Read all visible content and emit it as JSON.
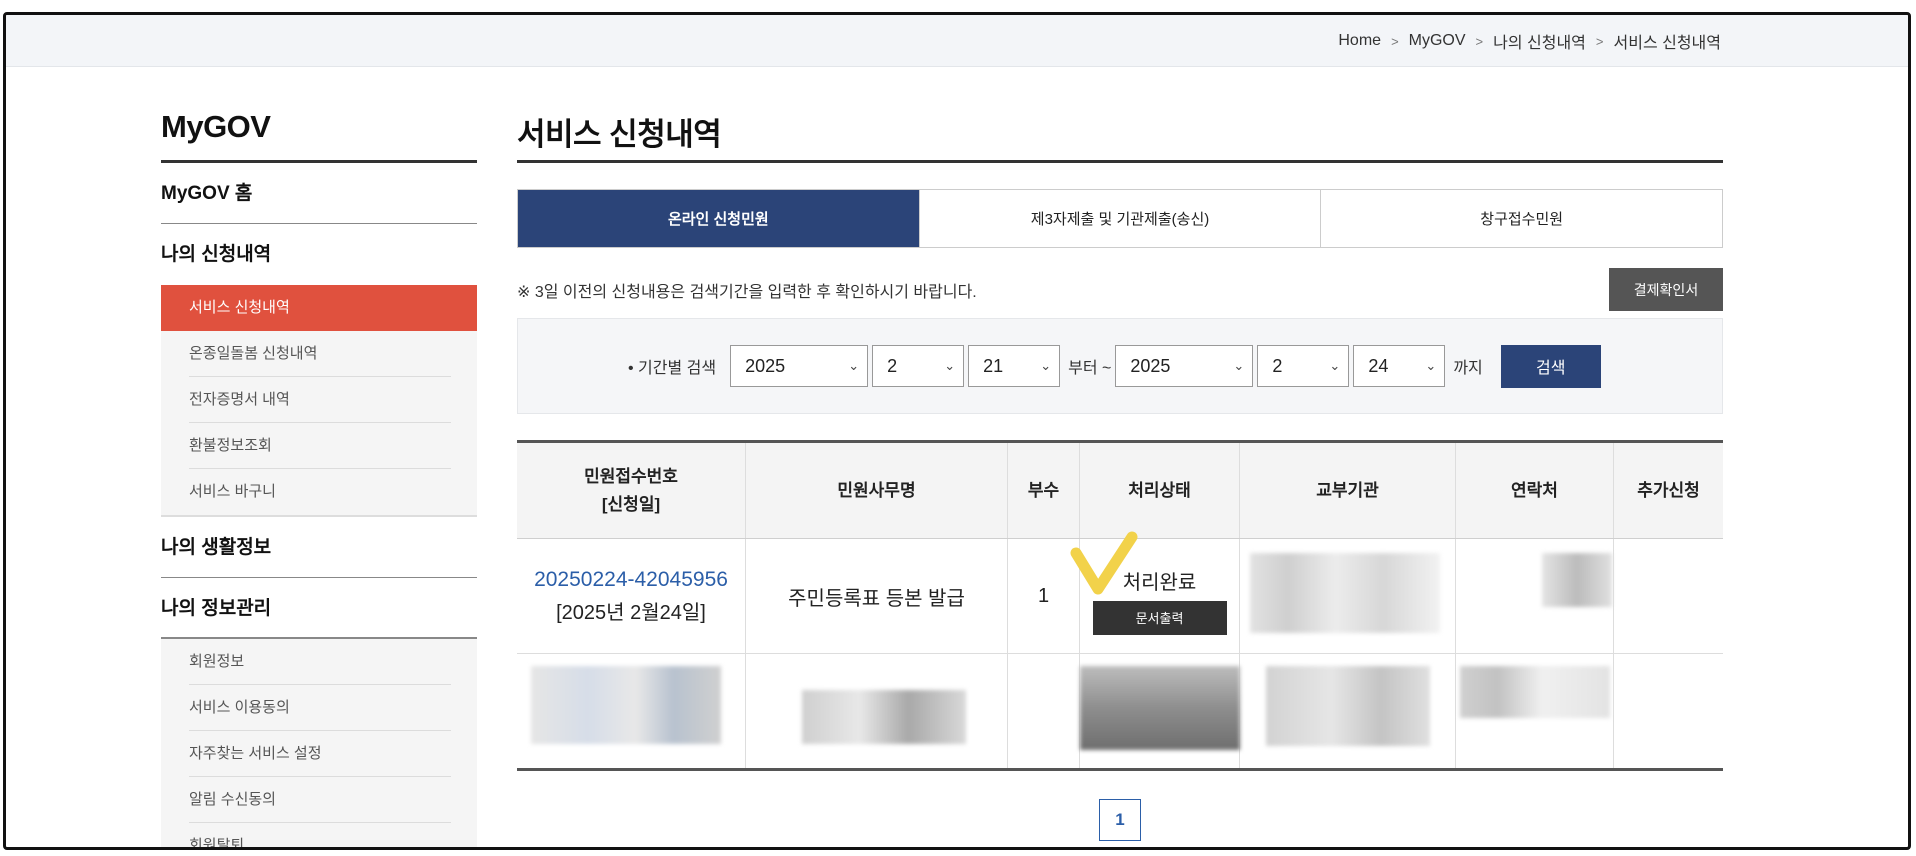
{
  "breadcrumb": [
    "Home",
    "MyGOV",
    "나의 신청내역",
    "서비스 신청내역"
  ],
  "sidebar": {
    "title": "MyGOV",
    "home": "MyGOV 홈",
    "section_apply": "나의 신청내역",
    "apply_items": [
      "서비스 신청내역",
      "온종일돌봄 신청내역",
      "전자증명서 내역",
      "환불정보조회",
      "서비스 바구니"
    ],
    "section_life": "나의 생활정보",
    "section_info": "나의 정보관리",
    "info_items": [
      "회원정보",
      "서비스 이용동의",
      "자주찾는 서비스 설정",
      "알림 수신동의",
      "회원탈퇴"
    ]
  },
  "main": {
    "title": "서비스 신청내역",
    "tabs": [
      "온라인 신청민원",
      "제3자제출 및 기관제출(송신)",
      "창구접수민원"
    ],
    "notice": "※ 3일 이전의 신청내용은 검색기간을 입력한 후 확인하시기 바랍니다.",
    "pay_button": "결제확인서",
    "search": {
      "label": "• 기간별 검색",
      "from_year": "2025",
      "from_month": "2",
      "from_day": "21",
      "from_text": "부터 ~",
      "to_year": "2025",
      "to_month": "2",
      "to_day": "24",
      "to_text": "까지",
      "button": "검색"
    },
    "table": {
      "headers": [
        "민원접수번호",
        "[신청일]",
        "민원사무명",
        "부수",
        "처리상태",
        "교부기관",
        "연락처",
        "추가신청"
      ],
      "row": {
        "receipt_no": "20250224-42045956",
        "date": "[2025년 2월24일]",
        "service": "주민등록표 등본 발급",
        "copies": "1",
        "status": "처리완료",
        "print_button": "문서출력"
      }
    },
    "pagination": [
      "1"
    ]
  },
  "colors": {
    "tab_active": "#2b4478",
    "sidebar_active": "#e0513e",
    "link_blue": "#2b5ea8",
    "checkmark": "#f2d24a"
  }
}
